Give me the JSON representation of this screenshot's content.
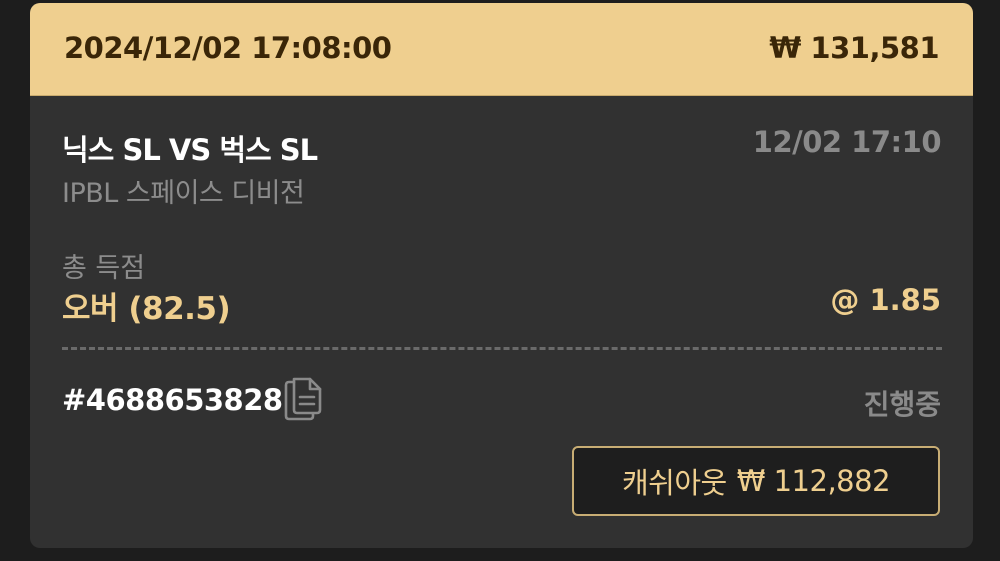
{
  "header": {
    "datetime": "2024/12/02 17:08:00",
    "stake": "₩ 131,581"
  },
  "match": {
    "title": "닉스 SL VS 벅스 SL",
    "league": "IPBL 스페이스 디비전",
    "start_time": "12/02 17:10"
  },
  "bet": {
    "market": "총 득점",
    "selection": "오버 (82.5)",
    "odds": "@ 1.85"
  },
  "ticket": {
    "id": "#4688653828",
    "status": "진행중"
  },
  "cashout": {
    "label": "캐쉬아웃",
    "amount": "₩ 112,882"
  },
  "colors": {
    "header_bg": "#efcf8f",
    "card_bg": "#313131",
    "accent": "#efcf8f",
    "muted": "#8a8a8a"
  },
  "icons": {
    "copy": "copy-icon"
  }
}
